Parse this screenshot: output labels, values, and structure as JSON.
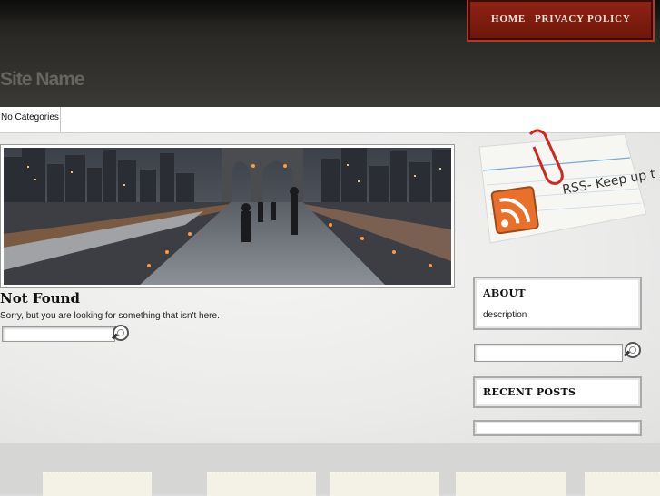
{
  "nav": {
    "home": "HOME",
    "privacy": "PRIVACY POLICY"
  },
  "header": {
    "site_name": "Site Name"
  },
  "categories": {
    "label": "No Categories"
  },
  "main": {
    "title": "Not Found",
    "message": "Sorry, but you are looking for something that isn't here.",
    "search_value": ""
  },
  "sidebar": {
    "rss_text": "RSS- Keep up to date",
    "about_title": "ABOUT",
    "about_desc": "description",
    "search_value": "",
    "recent_title": "RECENT POSTS"
  },
  "icons": [
    "search-icon",
    "rss-icon",
    "paperclip-icon"
  ],
  "colors": {
    "nav_bg": "#8f2313",
    "header_bg": "#2a2926",
    "rss_orange": "#e8702a"
  }
}
